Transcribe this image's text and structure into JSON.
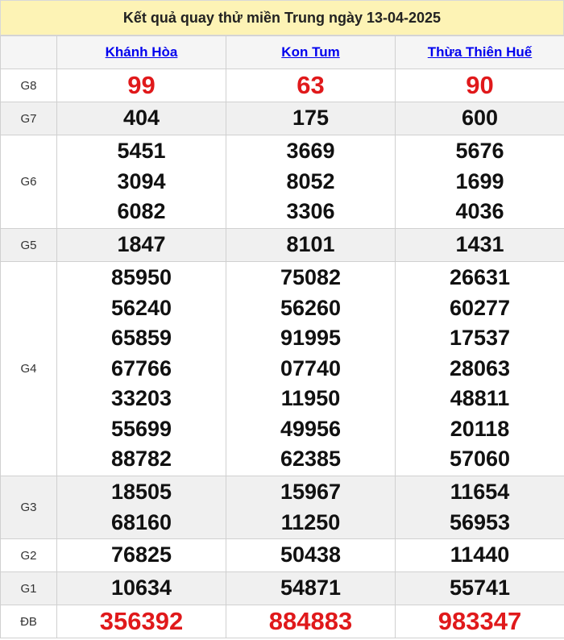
{
  "title": "Kết quả quay thử miền Trung ngày 13-04-2025",
  "provinces": [
    "Khánh Hòa",
    "Kon Tum",
    "Thừa Thiên Huế"
  ],
  "colors": {
    "header_bg": "#fdf3b5",
    "link": "#0000ee",
    "highlight": "#e0191b",
    "alt_row": "#f0f0f0"
  },
  "rows": [
    {
      "label": "G8",
      "highlight": true,
      "alt": false,
      "values": [
        [
          "99"
        ],
        [
          "63"
        ],
        [
          "90"
        ]
      ]
    },
    {
      "label": "G7",
      "highlight": false,
      "alt": true,
      "values": [
        [
          "404"
        ],
        [
          "175"
        ],
        [
          "600"
        ]
      ]
    },
    {
      "label": "G6",
      "highlight": false,
      "alt": false,
      "values": [
        [
          "5451",
          "3094",
          "6082"
        ],
        [
          "3669",
          "8052",
          "3306"
        ],
        [
          "5676",
          "1699",
          "4036"
        ]
      ]
    },
    {
      "label": "G5",
      "highlight": false,
      "alt": true,
      "values": [
        [
          "1847"
        ],
        [
          "8101"
        ],
        [
          "1431"
        ]
      ]
    },
    {
      "label": "G4",
      "highlight": false,
      "alt": false,
      "values": [
        [
          "85950",
          "56240",
          "65859",
          "67766",
          "33203",
          "55699",
          "88782"
        ],
        [
          "75082",
          "56260",
          "91995",
          "07740",
          "11950",
          "49956",
          "62385"
        ],
        [
          "26631",
          "60277",
          "17537",
          "28063",
          "48811",
          "20118",
          "57060"
        ]
      ]
    },
    {
      "label": "G3",
      "highlight": false,
      "alt": true,
      "values": [
        [
          "18505",
          "68160"
        ],
        [
          "15967",
          "11250"
        ],
        [
          "11654",
          "56953"
        ]
      ]
    },
    {
      "label": "G2",
      "highlight": false,
      "alt": false,
      "values": [
        [
          "76825"
        ],
        [
          "50438"
        ],
        [
          "11440"
        ]
      ]
    },
    {
      "label": "G1",
      "highlight": false,
      "alt": true,
      "values": [
        [
          "10634"
        ],
        [
          "54871"
        ],
        [
          "55741"
        ]
      ]
    },
    {
      "label": "ĐB",
      "highlight": true,
      "alt": false,
      "values": [
        [
          "356392"
        ],
        [
          "884883"
        ],
        [
          "983347"
        ]
      ]
    }
  ]
}
